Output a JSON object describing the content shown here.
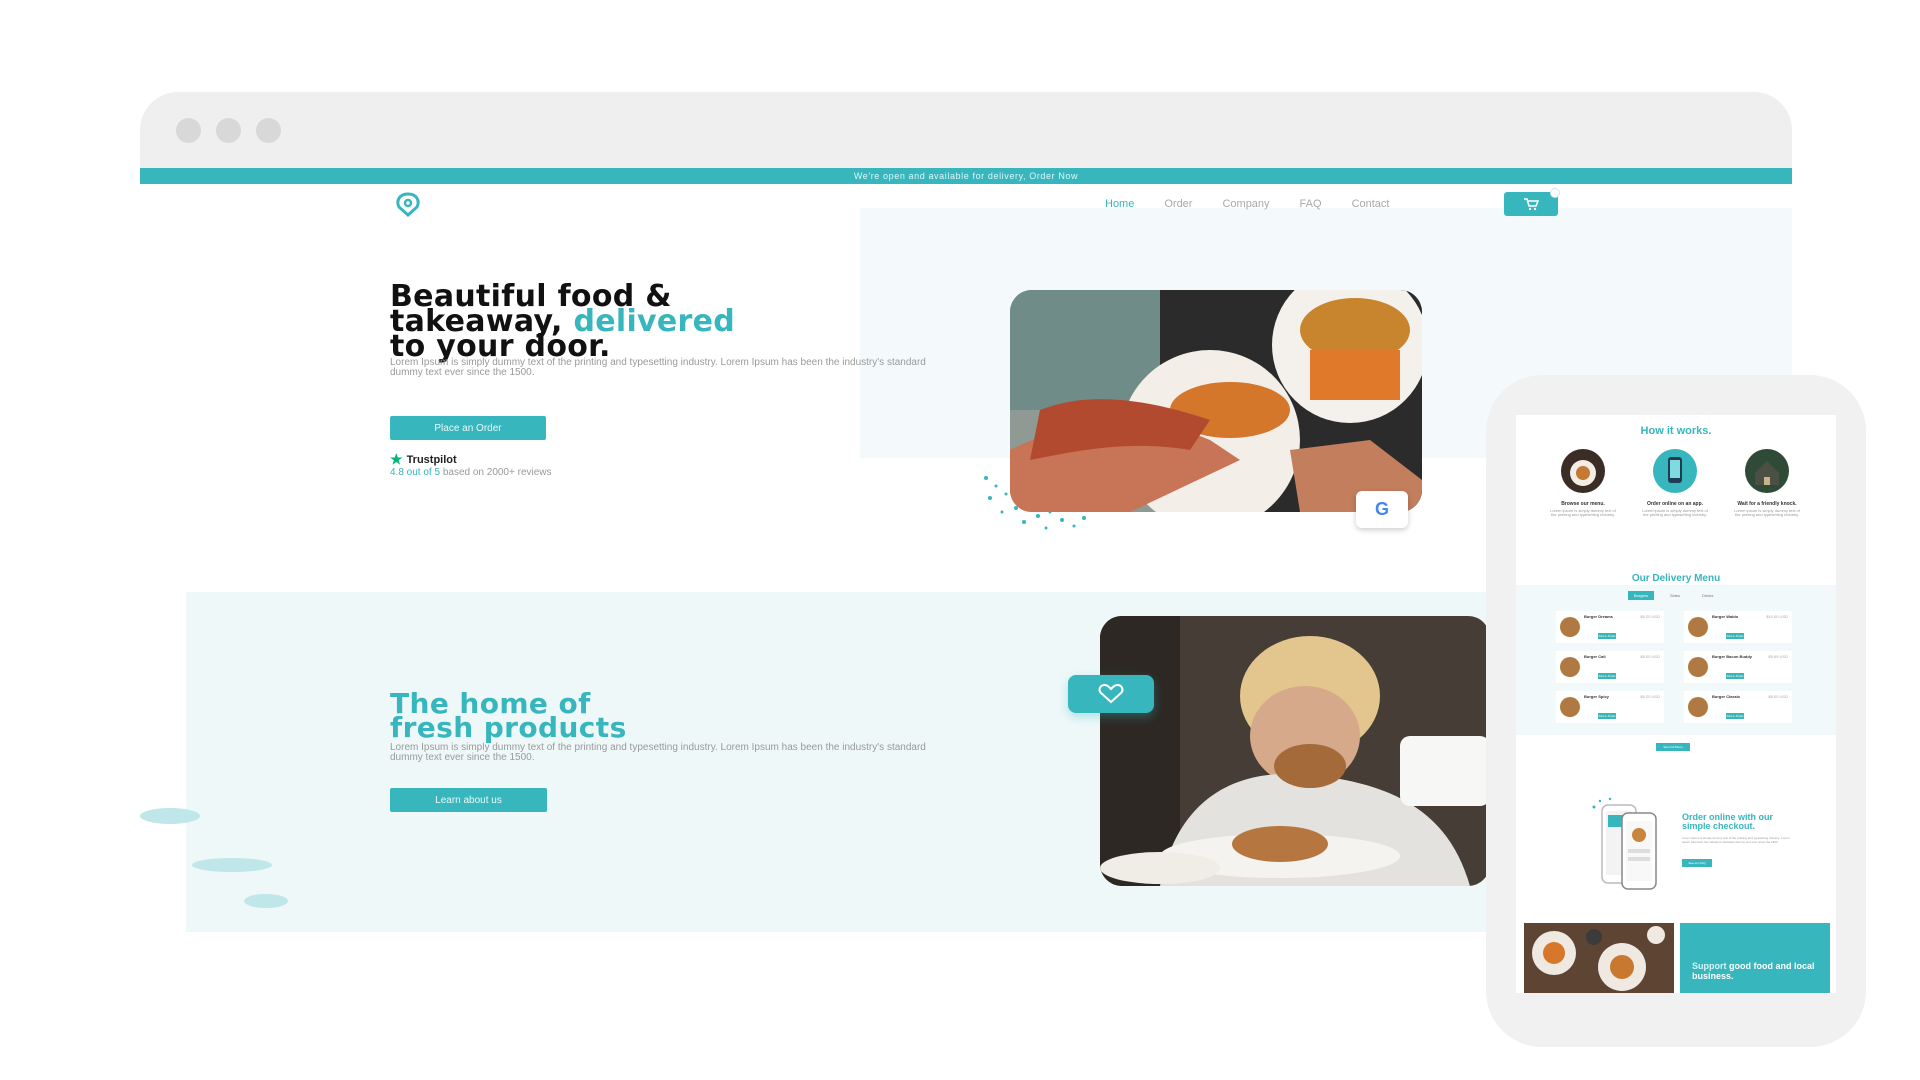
{
  "colors": {
    "accent": "#37b6bd",
    "dark": "#111111",
    "muted": "#9a9a9a",
    "chrome": "#efefef"
  },
  "banner": {
    "text": "We're open and available for delivery, Order Now"
  },
  "nav": {
    "links": [
      "Home",
      "Order",
      "Company",
      "FAQ",
      "Contact"
    ],
    "active": "Home",
    "cart_icon": "cart-icon"
  },
  "hero": {
    "title_line1": "Beautiful food &",
    "title_line2_prefix": "takeaway, ",
    "title_line2_accent": "delivered",
    "title_line3": "to your door.",
    "text": "Lorem Ipsum is simply dummy text of the printing and typesetting industry. Lorem Ipsum has been the industry's standard dummy text ever since the 1500.",
    "button": "Place an Order",
    "trustpilot": "Trustpilot",
    "rating_highlight": "4.8 out of 5",
    "rating_rest": " based on 2000+ reviews",
    "badge_letter": "G"
  },
  "home": {
    "title_line1": "The home of",
    "title_line2": "fresh products",
    "text": "Lorem Ipsum is simply dummy text of the printing and typesetting industry. Lorem Ipsum has been the industry's standard dummy text ever since the 1500.",
    "button": "Learn about us"
  },
  "phone": {
    "how_title": "How it works.",
    "steps": [
      {
        "title": "Browse our menu.",
        "text": "Lorem ipsum is simply dummy text of the printing and typesetting industry."
      },
      {
        "title": "Order online on an app.",
        "text": "Lorem ipsum is simply dummy text of the printing and typesetting industry."
      },
      {
        "title": "Wait for a friendly knock.",
        "text": "Lorem ipsum is simply dummy text of the printing and typesetting industry."
      }
    ],
    "menu_title": "Our Delivery Menu",
    "menu_tabs": [
      "Burgers",
      "Sides",
      "Drinks"
    ],
    "menu_items": [
      {
        "name": "Burger Dreams",
        "price": "$9.20 USD",
        "button": "Add to Order"
      },
      {
        "name": "Burger Waldo",
        "price": "$10.00 USD",
        "button": "Add to Order"
      },
      {
        "name": "Burger Cali",
        "price": "$8.00 USD",
        "button": "Add to Order"
      },
      {
        "name": "Burger Bacon Buddy",
        "price": "$9.99 USD",
        "button": "Add to Order"
      },
      {
        "name": "Burger Spicy",
        "price": "$9.20 USD",
        "button": "Add to Order"
      },
      {
        "name": "Burger Classic",
        "price": "$8.00 USD",
        "button": "Add to Order"
      }
    ],
    "see_all": "See Full Menu",
    "checkout_title": "Order online with our simple checkout.",
    "checkout_text": "Lorem ipsum is simply dummy text of the printing and typesetting industry. Lorem Ipsum has been the industry's standard dummy text ever since the 1500.",
    "checkout_button": "See our FAQ",
    "support_highlight": "Support",
    "support_rest": " good food and local business."
  }
}
